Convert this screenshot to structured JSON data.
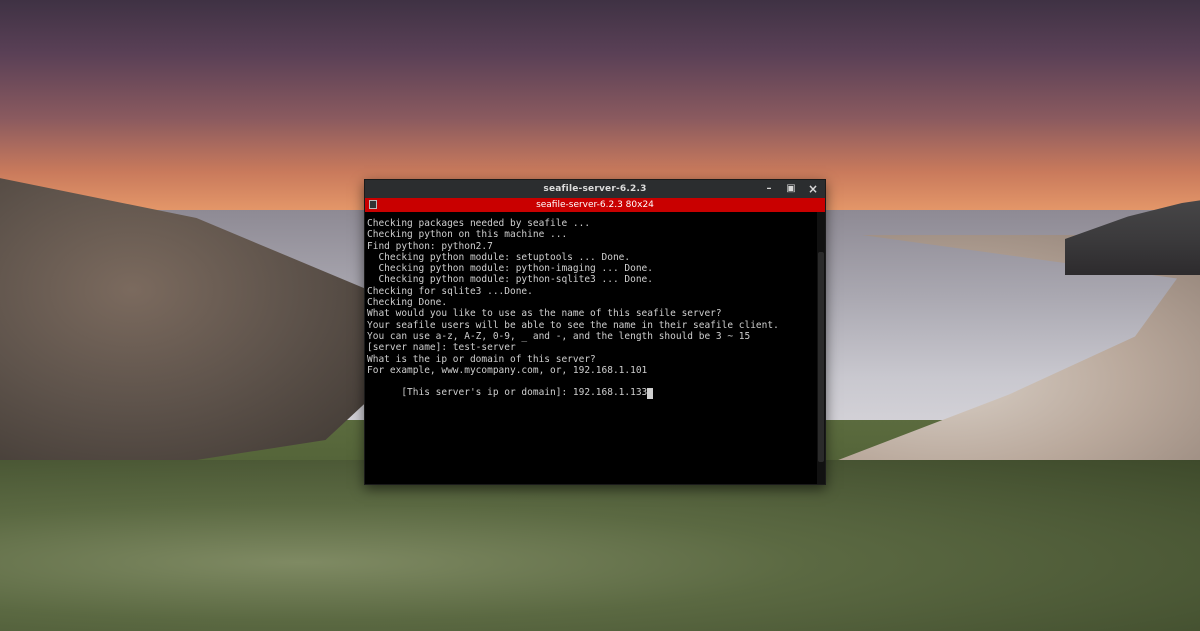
{
  "window": {
    "title": "seafile-server-6.2.3",
    "tab_title": "seafile-server-6.2.3 80x24",
    "controls": {
      "minimize_icon": "minimize-icon",
      "maximize_icon": "maximize-icon",
      "close_icon": "close-icon"
    }
  },
  "terminal": {
    "lines": [
      "",
      "Checking packages needed by seafile ...",
      "",
      "Checking python on this machine ...",
      "Find python: python2.7",
      "",
      "  Checking python module: setuptools ... Done.",
      "  Checking python module: python-imaging ... Done.",
      "  Checking python module: python-sqlite3 ... Done.",
      "",
      "Checking for sqlite3 ...Done.",
      "",
      "Checking Done.",
      "",
      "",
      "What would you like to use as the name of this seafile server?",
      "Your seafile users will be able to see the name in their seafile client.",
      "You can use a-z, A-Z, 0-9, _ and -, and the length should be 3 ~ 15",
      "[server name]: test-server",
      "",
      "What is the ip or domain of this server?",
      "For example, www.mycompany.com, or, 192.168.1.101",
      "",
      "[This server's ip or domain]: 192.168.1.133"
    ]
  }
}
